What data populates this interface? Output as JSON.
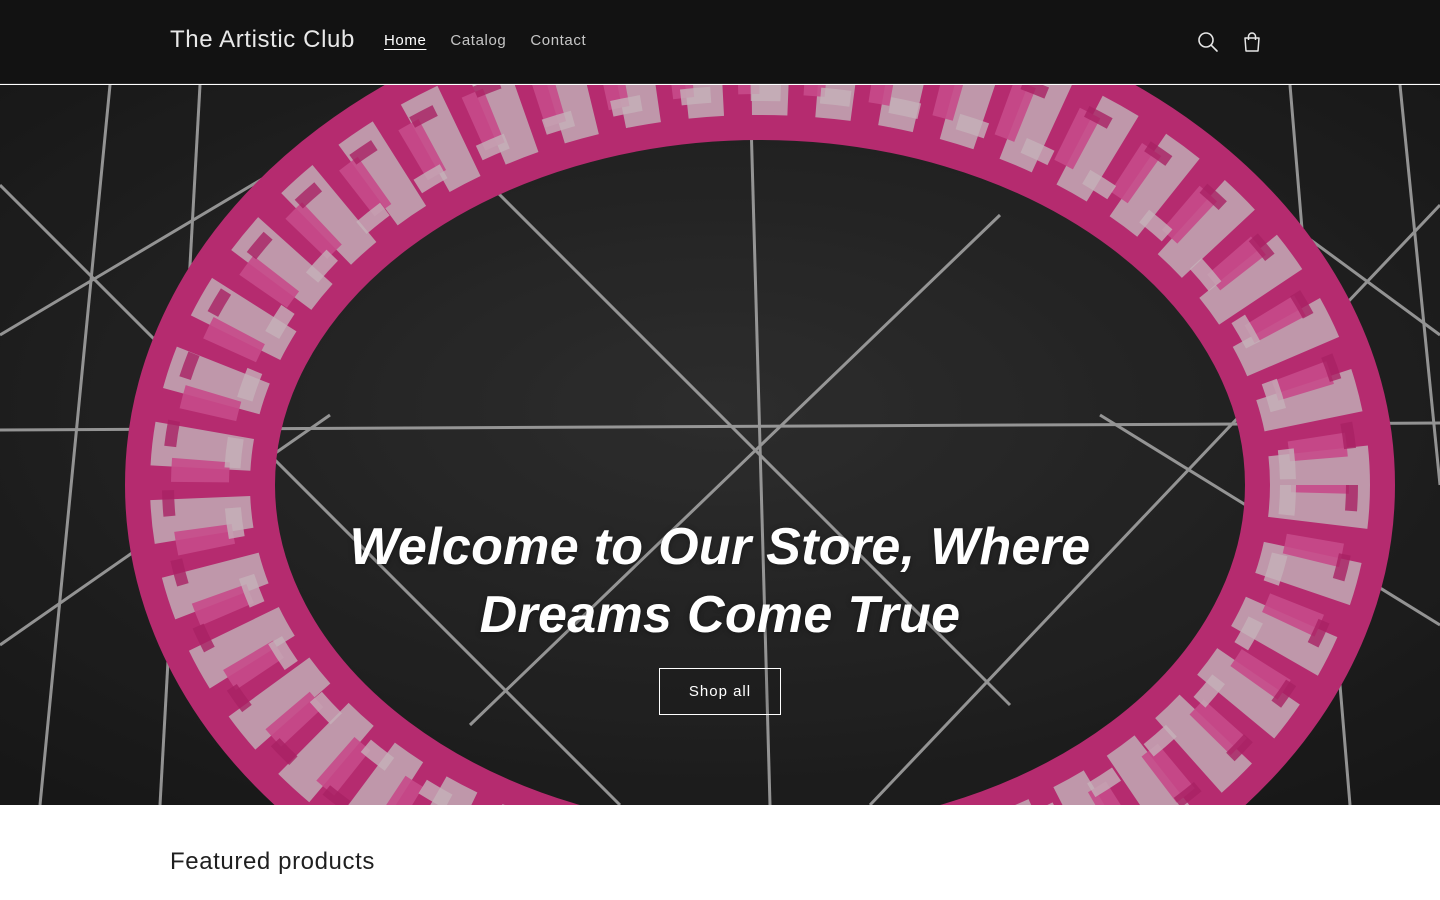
{
  "header": {
    "brand": "The Artistic Club",
    "nav": [
      {
        "label": "Home",
        "active": true
      },
      {
        "label": "Catalog",
        "active": false
      },
      {
        "label": "Contact",
        "active": false
      }
    ],
    "icons": {
      "search": "search-icon",
      "cart": "cart-icon"
    }
  },
  "hero": {
    "heading": "Welcome to Our Store, Where Dreams Come True",
    "button_label": "Shop all",
    "image": "pink-and-white-rubber-band-bracelet-photo"
  },
  "featured": {
    "title": "Featured products"
  },
  "colors": {
    "header_bg": "#121212",
    "accent_pink": "#f0409a",
    "text_dark": "#1f1f1f"
  }
}
